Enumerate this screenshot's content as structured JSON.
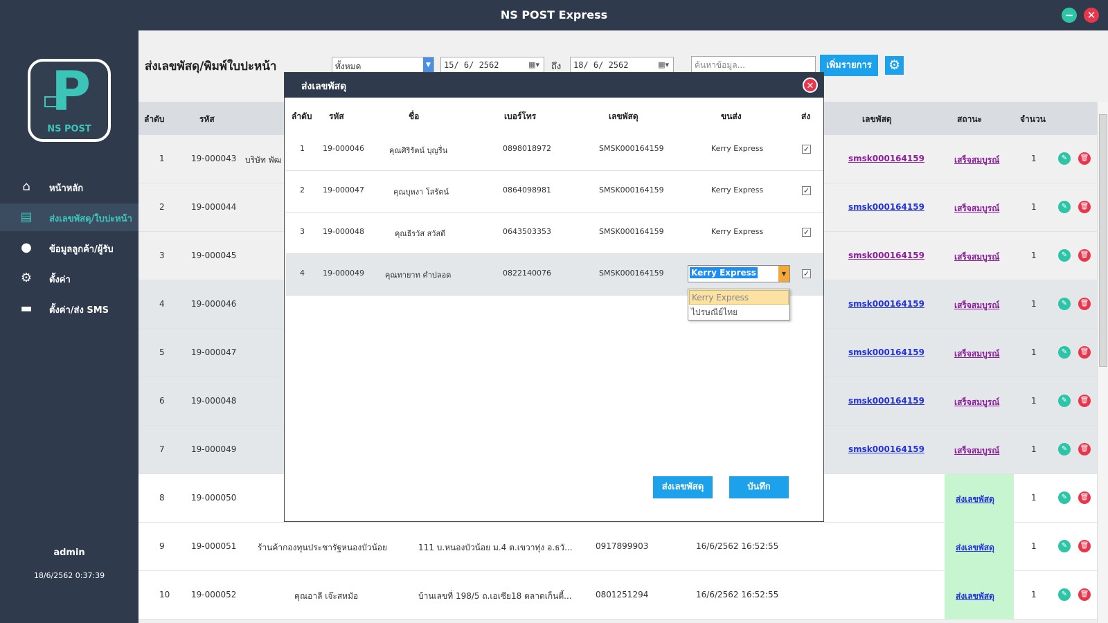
{
  "window": {
    "title": "NS POST Express",
    "minimize_label": "−",
    "close_label": "✕"
  },
  "sidebar": {
    "logo_text": "NS POST",
    "logo_letter": "P",
    "items": [
      {
        "label": "หน้าหลัก",
        "icon": "home-icon",
        "glyph": "⌂"
      },
      {
        "label": "ส่งเลขพัสดุ/ใบปะหน้า",
        "icon": "document-icon",
        "glyph": "▤"
      },
      {
        "label": "ข้อมูลลูกค้า/ผู้รับ",
        "icon": "users-icon",
        "glyph": "●"
      },
      {
        "label": "ตั้งค่า",
        "icon": "gear-icon",
        "glyph": "⚙"
      },
      {
        "label": "ตั้งค่า/ส่ง SMS",
        "icon": "chat-icon",
        "glyph": "▬"
      }
    ],
    "user": "admin",
    "datetime": "18/6/2562 0:37:39"
  },
  "header": {
    "title": "ส่งเลขพัสดุ/พิมพ์ใบปะหน้า",
    "filter_value": "ทั้งหมด",
    "date_from": "15/ 6/ 2562",
    "to_label": "ถึง",
    "date_to": "18/ 6/ 2562",
    "search_placeholder": "ค้นหาข้อมูล...",
    "add_label": "เพิ่มรายการ",
    "settings_icon": "gear-icon"
  },
  "table": {
    "columns": [
      "ลำดับ",
      "รหัส",
      "เลขพัสดุ",
      "สถานะ",
      "จำนวน"
    ],
    "rows": [
      {
        "no": "1",
        "code": "19-000043",
        "name": "บริษัท พัฒ",
        "address": "",
        "phone": "",
        "date": "",
        "track": "smsk000164159",
        "status": "เสร็จสมบูรณ์",
        "qty": "1"
      },
      {
        "no": "2",
        "code": "19-000044",
        "name": "",
        "address": "",
        "phone": "",
        "date": "",
        "track": "smsk000164159",
        "status": "เสร็จสมบูรณ์",
        "qty": "1"
      },
      {
        "no": "3",
        "code": "19-000045",
        "name": "",
        "address": "",
        "phone": "",
        "date": "",
        "track": "smsk000164159",
        "status": "เสร็จสมบูรณ์",
        "qty": "1"
      },
      {
        "no": "4",
        "code": "19-000046",
        "name": "",
        "address": "",
        "phone": "",
        "date": "",
        "track": "smsk000164159",
        "status": "เสร็จสมบูรณ์",
        "qty": "1"
      },
      {
        "no": "5",
        "code": "19-000047",
        "name": "",
        "address": "",
        "phone": "",
        "date": "",
        "track": "smsk000164159",
        "status": "เสร็จสมบูรณ์",
        "qty": "1"
      },
      {
        "no": "6",
        "code": "19-000048",
        "name": "",
        "address": "",
        "phone": "",
        "date": "",
        "track": "smsk000164159",
        "status": "เสร็จสมบูรณ์",
        "qty": "1"
      },
      {
        "no": "7",
        "code": "19-000049",
        "name": "",
        "address": "",
        "phone": "",
        "date": "",
        "track": "smsk000164159",
        "status": "เสร็จสมบูรณ์",
        "qty": "1"
      },
      {
        "no": "8",
        "code": "19-000050",
        "name": "",
        "address": "",
        "phone": "",
        "date": "",
        "track": "",
        "status": "ส่งเลขพัสดุ",
        "qty": "1"
      },
      {
        "no": "9",
        "code": "19-000051",
        "name": "ร้านค้ากองทุนประชารัฐหนองบัวน้อย",
        "address": "111 บ.หนองบัวน้อย ม.4 ต.เขวาทุ่ง อ.ธวั...",
        "phone": "0917899903",
        "date": "16/6/2562 16:52:55",
        "track": "",
        "status": "ส่งเลขพัสดุ",
        "qty": "1"
      },
      {
        "no": "10",
        "code": "19-000052",
        "name": "คุณอาลี เจ๊ะสหมัอ",
        "address": "บ้านเลขที่ 198/5 ถ.เอเซีย18 ตลาดเก็นตี้...",
        "phone": "0801251294",
        "date": "16/6/2562 16:52:55",
        "track": "",
        "status": "ส่งเลขพัสดุ",
        "qty": "1"
      }
    ]
  },
  "modal": {
    "title": "ส่งเลขพัสดุ",
    "columns": [
      "ลำดับ",
      "รหัส",
      "ชื่อ",
      "เบอร์โทร",
      "เลขพัสดุ",
      "ขนส่ง",
      "ส่ง"
    ],
    "rows": [
      {
        "no": "1",
        "code": "19-000046",
        "name": "คุณศิริรัตน์ บุญรื่น",
        "phone": "0898018972",
        "track": "SMSK000164159",
        "carrier": "Kerry Express",
        "checked": "✓"
      },
      {
        "no": "2",
        "code": "19-000047",
        "name": "คุณบุหงา โสรัตน์",
        "phone": "0864098981",
        "track": "SMSK000164159",
        "carrier": "Kerry Express",
        "checked": "✓"
      },
      {
        "no": "3",
        "code": "19-000048",
        "name": "คุณธีรวัส สวัสดี",
        "phone": "0643503353",
        "track": "SMSK000164159",
        "carrier": "Kerry Express",
        "checked": "✓"
      },
      {
        "no": "4",
        "code": "19-000049",
        "name": "คุณทายาท คำปลอด",
        "phone": "0822140076",
        "track": "SMSK000164159",
        "carrier": "Kerry Express",
        "checked": "✓"
      }
    ],
    "dropdown_options": [
      "Kerry Express",
      "ไปรษณีย์ไทย"
    ],
    "send_label": "ส่งเลขพัสดุ",
    "save_label": "บันทึก"
  },
  "colors": {
    "sidebar": "#2f3b4d",
    "accent": "#1ca1ea",
    "teal": "#3dc4b8",
    "danger": "#e8374d",
    "success_bg": "#c7f5cf"
  }
}
